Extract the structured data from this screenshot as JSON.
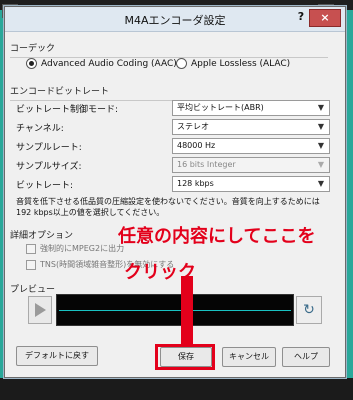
{
  "dialog": {
    "title": "M4Aエンコーダ設定",
    "help_glyph": "?",
    "close_glyph": "×"
  },
  "codec": {
    "section_title": "コーデック",
    "options": [
      {
        "label": "Advanced Audio Coding (AAC)",
        "selected": true
      },
      {
        "label": "Apple Lossless (ALAC)",
        "selected": false
      }
    ]
  },
  "bitrate": {
    "section_title": "エンコードビットレート",
    "rows": [
      {
        "label": "ビットレート制御モード:",
        "value": "平均ビットレート(ABR)",
        "enabled": true
      },
      {
        "label": "チャンネル:",
        "value": "ステレオ",
        "enabled": true
      },
      {
        "label": "サンプルレート:",
        "value": "48000 Hz",
        "enabled": true
      },
      {
        "label": "サンプルサイズ:",
        "value": "16 bits Integer",
        "enabled": false
      },
      {
        "label": "ビットレート:",
        "value": "128 kbps",
        "enabled": true
      }
    ],
    "note": "音質を低下させる低品質の圧縮設定を使わないでください。音質を向上するためには192 kbps以上の値を選択してください。"
  },
  "detail": {
    "section_title": "詳細オプション",
    "checks": [
      {
        "label": "強制的にMPEG2に出力",
        "checked": false
      },
      {
        "label": "TNS(時間領域雑音整形)を無効にする",
        "checked": false
      }
    ]
  },
  "preview": {
    "section_title": "プレビュー",
    "loop_glyph": "↻"
  },
  "buttons": {
    "reset": "デフォルトに戻す",
    "save": "保存",
    "cancel": "キャンセル",
    "help": "ヘルプ"
  },
  "annotation": {
    "line1": "任意の内容にしてここを",
    "line2": "クリック",
    "color": "#e3001b"
  }
}
